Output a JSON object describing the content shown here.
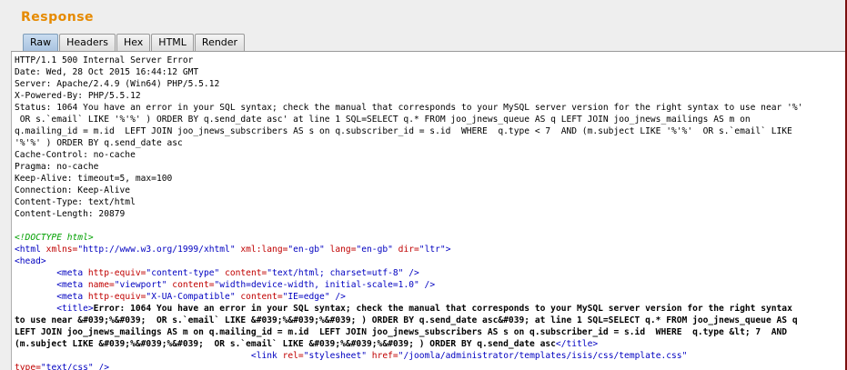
{
  "panel": {
    "title": "Response",
    "tabs": [
      {
        "label": "Raw",
        "active": true
      },
      {
        "label": "Headers",
        "active": false
      },
      {
        "label": "Hex",
        "active": false
      },
      {
        "label": "HTML",
        "active": false
      },
      {
        "label": "Render",
        "active": false
      }
    ]
  },
  "headers": [
    "HTTP/1.1 500 Internal Server Error",
    "Date: Wed, 28 Oct 2015 16:44:12 GMT",
    "Server: Apache/2.4.9 (Win64) PHP/5.5.12",
    "X-Powered-By: PHP/5.5.12",
    "Status: 1064 You have an error in your SQL syntax; check the manual that corresponds to your MySQL server version for the right syntax to use near '%'",
    " OR s.`email` LIKE '%'%' ) ORDER BY q.send_date asc' at line 1 SQL=SELECT q.* FROM joo_jnews_queue AS q LEFT JOIN joo_jnews_mailings AS m on",
    "q.mailing_id = m.id  LEFT JOIN joo_jnews_subscribers AS s on q.subscriber_id = s.id  WHERE  q.type < 7  AND (m.subject LIKE '%'%'  OR s.`email` LIKE",
    "'%'%' ) ORDER BY q.send_date asc",
    "Cache-Control: no-cache",
    "Pragma: no-cache",
    "Keep-Alive: timeout=5, max=100",
    "Connection: Keep-Alive",
    "Content-Type: text/html",
    "Content-Length: 20879"
  ],
  "body": {
    "doctype": "<!DOCTYPE html>",
    "html_open": {
      "lt": "<html",
      "a1": " xmlns=",
      "v1": "\"http://www.w3.org/1999/xhtml\"",
      "a2": " xml:lang=",
      "v2": "\"en-gb\"",
      "a3": " lang=",
      "v3": "\"en-gb\"",
      "a4": " dir=",
      "v4": "\"ltr\"",
      "gt": ">"
    },
    "head_open": "<head>",
    "meta1": {
      "indent": "        ",
      "lt": "<meta",
      "a1": " http-equiv=",
      "v1": "\"content-type\"",
      "a2": " content=",
      "v2": "\"text/html; charset=utf-8\"",
      "gt": " />"
    },
    "meta2": {
      "indent": "        ",
      "lt": "<meta",
      "a1": " name=",
      "v1": "\"viewport\"",
      "a2": " content=",
      "v2": "\"width=device-width, initial-scale=1.0\"",
      "gt": " />"
    },
    "meta3": {
      "indent": "        ",
      "lt": "<meta",
      "a1": " http-equiv=",
      "v1": "\"X-UA-Compatible\"",
      "a2": " content=",
      "v2": "\"IE=edge\"",
      "gt": " />"
    },
    "title": {
      "indent": "        ",
      "open": "<title>",
      "line1": "Error: 1064 You have an error in your SQL syntax; check the manual that corresponds to your MySQL server version for the right syntax",
      "line2": "to use near &#039;%&#039;  OR s.`email` LIKE &#039;%&#039;%&#039; ) ORDER BY q.send_date asc&#039; at line 1 SQL=SELECT q.* FROM joo_jnews_queue AS q",
      "line3": "LEFT JOIN joo_jnews_mailings AS m on q.mailing_id = m.id  LEFT JOIN joo_jnews_subscribers AS s on q.subscriber_id = s.id  WHERE  q.type &lt; 7  AND",
      "line4": "(m.subject LIKE &#039;%&#039;%&#039;  OR s.`email` LIKE &#039;%&#039;%&#039; ) ORDER BY q.send_date asc",
      "close": "</title>"
    },
    "link": {
      "indent": "                                             ",
      "lt": "<link",
      "a1": " rel=",
      "v1": "\"stylesheet\"",
      "a2": " href=",
      "v2": "\"/joomla/administrator/templates/isis/css/template.css\"",
      "gt": ""
    },
    "last": {
      "a1": "type=",
      "v1": "\"text/css\"",
      "gt": " />"
    }
  }
}
